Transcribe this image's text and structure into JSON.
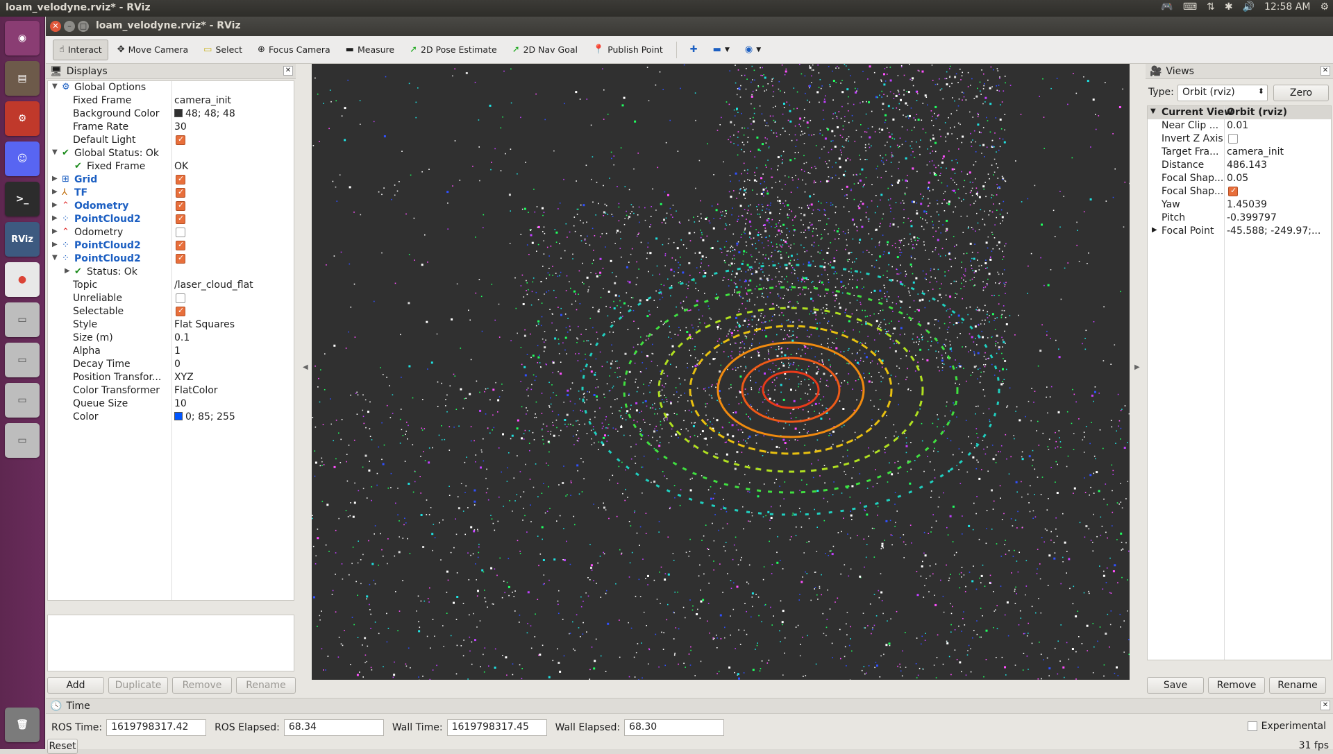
{
  "panel": {
    "window_title": "loam_velodyne.rviz* - RViz",
    "time": "12:58 AM"
  },
  "window": {
    "title": "loam_velodyne.rviz* - RViz"
  },
  "toolbar": {
    "interact": "Interact",
    "move_camera": "Move Camera",
    "select": "Select",
    "focus_camera": "Focus Camera",
    "measure": "Measure",
    "pose_estimate": "2D Pose Estimate",
    "nav_goal": "2D Nav Goal",
    "publish_point": "Publish Point"
  },
  "displays": {
    "header": "Displays",
    "global_options": "Global Options",
    "fixed_frame_label": "Fixed Frame",
    "fixed_frame_value": "camera_init",
    "bg_color_label": "Background Color",
    "bg_color_value": "48; 48; 48",
    "bg_color_hex": "#303030",
    "frame_rate_label": "Frame Rate",
    "frame_rate_value": "30",
    "default_light_label": "Default Light",
    "global_status": "Global Status: Ok",
    "gs_fixed_frame_label": "Fixed Frame",
    "gs_fixed_frame_value": "OK",
    "items": [
      {
        "label": "Grid",
        "checked": true
      },
      {
        "label": "TF",
        "checked": true
      },
      {
        "label": "Odometry",
        "checked": true
      },
      {
        "label": "PointCloud2",
        "checked": true
      },
      {
        "label": "Odometry",
        "checked": false
      },
      {
        "label": "PointCloud2",
        "checked": true
      },
      {
        "label": "PointCloud2",
        "checked": true
      }
    ],
    "status_ok": "Status: Ok",
    "props": [
      {
        "label": "Topic",
        "value": "/laser_cloud_flat"
      },
      {
        "label": "Unreliable",
        "value": ""
      },
      {
        "label": "Selectable",
        "value": ""
      },
      {
        "label": "Style",
        "value": "Flat Squares"
      },
      {
        "label": "Size (m)",
        "value": "0.1"
      },
      {
        "label": "Alpha",
        "value": "1"
      },
      {
        "label": "Decay Time",
        "value": "0"
      },
      {
        "label": "Position Transfor...",
        "value": "XYZ"
      },
      {
        "label": "Color Transformer",
        "value": "FlatColor"
      },
      {
        "label": "Queue Size",
        "value": "10"
      },
      {
        "label": "Color",
        "value": "0; 85; 255"
      }
    ],
    "color_hex": "#0055ff",
    "add": "Add",
    "duplicate": "Duplicate",
    "remove": "Remove",
    "rename": "Rename"
  },
  "views": {
    "header": "Views",
    "type_label": "Type:",
    "type_value": "Orbit (rviz)",
    "zero": "Zero",
    "current_view": "Current View",
    "current_view_type": "Orbit (rviz)",
    "props": [
      {
        "label": "Near Clip ...",
        "value": "0.01"
      },
      {
        "label": "Invert Z Axis",
        "value": ""
      },
      {
        "label": "Target Fra...",
        "value": "camera_init"
      },
      {
        "label": "Distance",
        "value": "486.143"
      },
      {
        "label": "Focal Shap...",
        "value": "0.05"
      },
      {
        "label": "Focal Shap...",
        "value": ""
      },
      {
        "label": "Yaw",
        "value": "1.45039"
      },
      {
        "label": "Pitch",
        "value": "-0.399797"
      },
      {
        "label": "Focal Point",
        "value": "-45.588; -249.97;..."
      }
    ],
    "save": "Save",
    "remove": "Remove",
    "rename": "Rename"
  },
  "time": {
    "header": "Time",
    "ros_time_label": "ROS Time:",
    "ros_time": "1619798317.42",
    "ros_elapsed_label": "ROS Elapsed:",
    "ros_elapsed": "68.34",
    "wall_time_label": "Wall Time:",
    "wall_time": "1619798317.45",
    "wall_elapsed_label": "Wall Elapsed:",
    "wall_elapsed": "68.30",
    "experimental": "Experimental",
    "reset": "Reset",
    "fps": "31 fps"
  }
}
